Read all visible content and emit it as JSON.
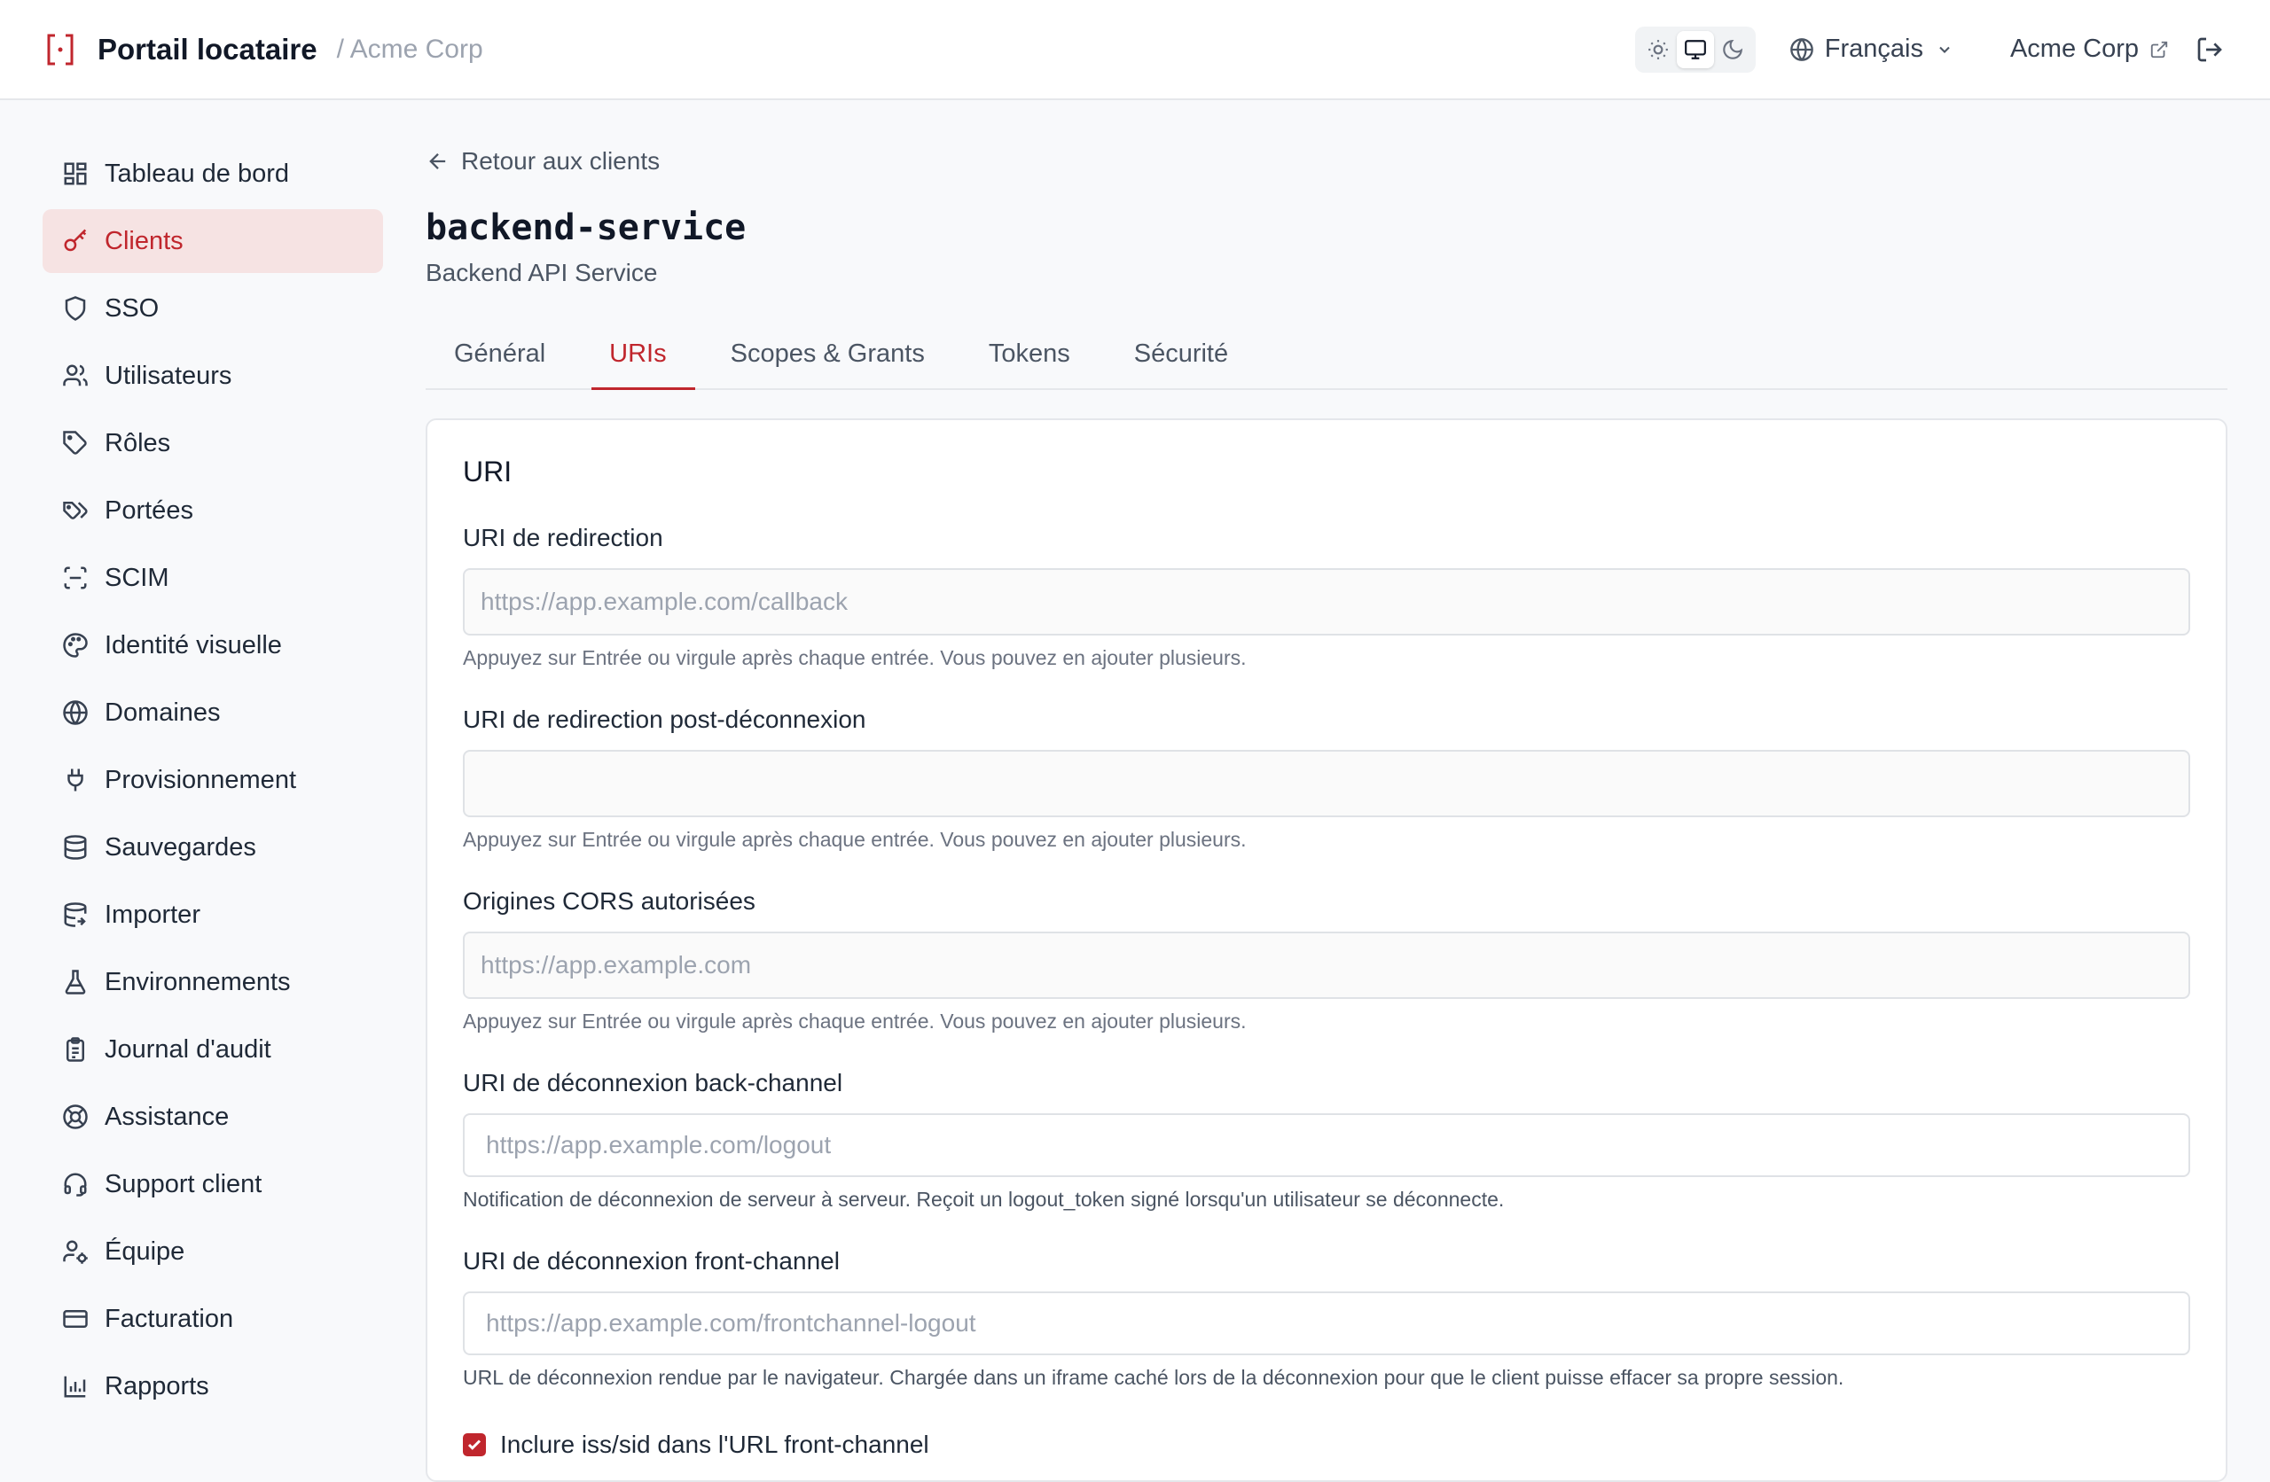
{
  "header": {
    "app_title": "Portail locataire",
    "org_crumb": "/ Acme Corp",
    "language": "Français",
    "org_link": "Acme Corp",
    "accent": "#c0262d"
  },
  "sidebar": {
    "items": [
      {
        "label": "Tableau de bord",
        "icon": "dashboard-icon"
      },
      {
        "label": "Clients",
        "icon": "key-icon",
        "active": true
      },
      {
        "label": "SSO",
        "icon": "shield-icon"
      },
      {
        "label": "Utilisateurs",
        "icon": "users-icon"
      },
      {
        "label": "Rôles",
        "icon": "tag-icon"
      },
      {
        "label": "Portées",
        "icon": "tags-icon"
      },
      {
        "label": "SCIM",
        "icon": "scan-icon"
      },
      {
        "label": "Identité visuelle",
        "icon": "palette-icon"
      },
      {
        "label": "Domaines",
        "icon": "globe-icon"
      },
      {
        "label": "Provisionnement",
        "icon": "plug-icon"
      },
      {
        "label": "Sauvegardes",
        "icon": "database-icon"
      },
      {
        "label": "Importer",
        "icon": "database-import-icon"
      },
      {
        "label": "Environnements",
        "icon": "flask-icon"
      },
      {
        "label": "Journal d'audit",
        "icon": "clipboard-icon"
      },
      {
        "label": "Assistance",
        "icon": "lifebuoy-icon"
      },
      {
        "label": "Support client",
        "icon": "headset-icon"
      },
      {
        "label": "Équipe",
        "icon": "user-cog-icon"
      },
      {
        "label": "Facturation",
        "icon": "credit-card-icon"
      },
      {
        "label": "Rapports",
        "icon": "bar-chart-icon"
      }
    ]
  },
  "main": {
    "back_label": "Retour aux clients",
    "title": "backend-service",
    "subtitle": "Backend API Service",
    "tabs": [
      {
        "label": "Général"
      },
      {
        "label": "URIs",
        "active": true
      },
      {
        "label": "Scopes & Grants"
      },
      {
        "label": "Tokens"
      },
      {
        "label": "Sécurité"
      }
    ],
    "card_title": "URI",
    "fields": {
      "redirect": {
        "label": "URI de redirection",
        "placeholder": "https://app.example.com/callback",
        "help": "Appuyez sur Entrée ou virgule après chaque entrée. Vous pouvez en ajouter plusieurs."
      },
      "post_logout": {
        "label": "URI de redirection post-déconnexion",
        "placeholder": "",
        "help": "Appuyez sur Entrée ou virgule après chaque entrée. Vous pouvez en ajouter plusieurs."
      },
      "cors": {
        "label": "Origines CORS autorisées",
        "placeholder": "https://app.example.com",
        "help": "Appuyez sur Entrée ou virgule après chaque entrée. Vous pouvez en ajouter plusieurs."
      },
      "backchannel": {
        "label": "URI de déconnexion back-channel",
        "placeholder": "https://app.example.com/logout",
        "help": "Notification de déconnexion de serveur à serveur. Reçoit un logout_token signé lorsqu'un utilisateur se déconnecte."
      },
      "frontchannel": {
        "label": "URI de déconnexion front-channel",
        "placeholder": "https://app.example.com/frontchannel-logout",
        "help": "URL de déconnexion rendue par le navigateur. Chargée dans un iframe caché lors de la déconnexion pour que le client puisse effacer sa propre session."
      }
    },
    "include_iss_sid": {
      "label": "Inclure iss/sid dans l'URL front-channel",
      "checked": true
    }
  }
}
